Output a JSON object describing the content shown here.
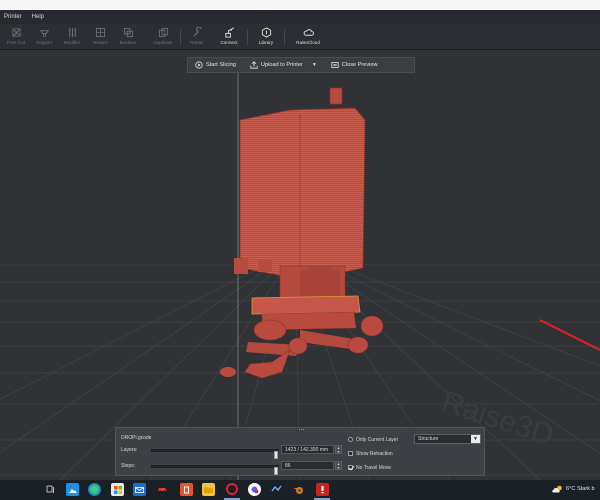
{
  "menu": {
    "items": [
      "Printer",
      "Help"
    ]
  },
  "toolbar": {
    "tools": [
      {
        "label": "Free Cut",
        "icon": "free-cut-icon",
        "state": "disabled"
      },
      {
        "label": "Support",
        "icon": "support-icon",
        "state": "disabled"
      },
      {
        "label": "Modifier",
        "icon": "modifier-icon",
        "state": "disabled"
      },
      {
        "label": "Texture",
        "icon": "texture-icon",
        "state": "disabled"
      },
      {
        "label": "Boolean",
        "icon": "boolean-icon",
        "state": "disabled"
      },
      {
        "label": "Duplicate",
        "icon": "duplicate-icon",
        "state": "disabled"
      },
      {
        "label": "Repair",
        "icon": "repair-icon",
        "state": "disabled"
      },
      {
        "label": "Connect",
        "icon": "connect-icon",
        "state": "enabled"
      },
      {
        "label": "Library",
        "icon": "library-icon",
        "state": "enabled"
      },
      {
        "label": "RaiseCloud",
        "icon": "cloud-icon",
        "state": "enabled"
      }
    ]
  },
  "preview_bar": {
    "start_slicing": "Start Slicing",
    "upload": "Upload to Printer",
    "close_preview": "Close Preview"
  },
  "layer_panel": {
    "filename": "DROPi.gcode",
    "layers_label": "Layers:",
    "layers_value": "1423 / 142.300 mm",
    "layers_fraction": 1.0,
    "steps_label": "Steps:",
    "steps_value": "86",
    "steps_fraction": 1.0,
    "only_current_layer": "Only Current Layer",
    "only_current_layer_checked": false,
    "show_retraction": "Show Retraction",
    "show_retraction_checked": false,
    "no_travel_move": "No Travel Move",
    "no_travel_move_checked": true,
    "view_mode": "Structure",
    "spin_up": "▲",
    "spin_down": "▼",
    "dropdown_arrow": "▼"
  },
  "taskbar": {
    "icons": [
      "task-view-icon",
      "photos-icon",
      "edge-icon",
      "store-icon",
      "mail-icon",
      "car-game-icon",
      "office-icon",
      "file-explorer-icon",
      "opera-icon",
      "app-icon",
      "steam-icon",
      "blender-icon",
      "ideamaker-icon"
    ],
    "weather": "6°C  Stark b"
  },
  "colors": {
    "model": "#b94a3f",
    "background": "#303236",
    "grid": "#4a4c50",
    "axis_red": "#e02020"
  }
}
